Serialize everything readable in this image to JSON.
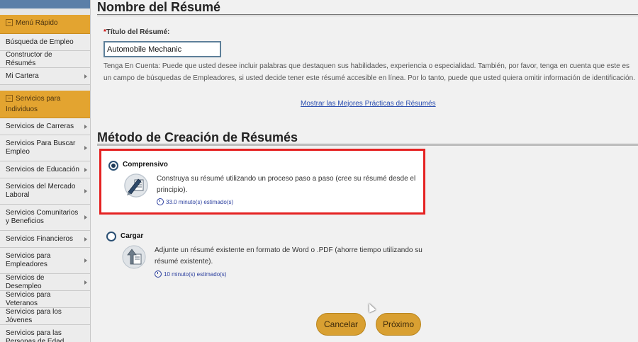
{
  "sidebar": {
    "quick_menu": {
      "header": "Menú Rápido",
      "items": [
        "Búsqueda de Empleo",
        "Constructor de Résumés",
        "Mi Cartera"
      ]
    },
    "services": {
      "header": "Servicios para Individuos",
      "items": [
        "Servicios de Carreras",
        "Servicios Para Buscar Empleo",
        "Servicios de Educación",
        "Servicios del Mercado Laboral",
        "Servicios Comunitarios y Beneficios",
        "Servicios Financieros",
        "Servicios para Empleadores",
        "Servicios de Desempleo",
        "Servicios para Veteranos",
        "Servicios para los Jóvenes",
        "Servicios para las Personas de Edad"
      ]
    }
  },
  "resume_section": {
    "title": "Nombre del Résumé",
    "field_label": "Título del Résumé:",
    "required_mark": "*",
    "title_value": "Automobile Mechanic",
    "note": "Tenga En Cuenta: Puede que usted desee incluir palabras que destaquen sus habilidades, experiencia o especialidad. También, por favor, tenga en cuenta que este es un campo de búsquedas de Empleadores, si usted decide tener este résumé accesible en línea. Por lo tanto, puede que usted quiera omitir información de identificación.",
    "best_practices_link": "Mostrar las Mejores Prácticas de Résumés"
  },
  "method_section": {
    "title": "Método de Creación de Résumés",
    "options": [
      {
        "label": "Comprensivo",
        "description": "Construya su résumé utilizando un proceso paso a paso (cree su résumé desde el principio).",
        "time": "33.0 minuto(s) estimado(s)",
        "selected": true,
        "icon": "pencil-document-icon"
      },
      {
        "label": "Cargar",
        "description": "Adjunte un résumé existente en formato de Word o .PDF (ahorre tiempo utilizando su résumé existente).",
        "time": "10 minuto(s) estimado(s)",
        "selected": false,
        "icon": "upload-document-icon"
      }
    ]
  },
  "buttons": {
    "cancel": "Cancelar",
    "next": "Próximo"
  },
  "colors": {
    "accent": "#e3a430",
    "highlight_border": "#e52222",
    "link": "#2c4fb0"
  }
}
